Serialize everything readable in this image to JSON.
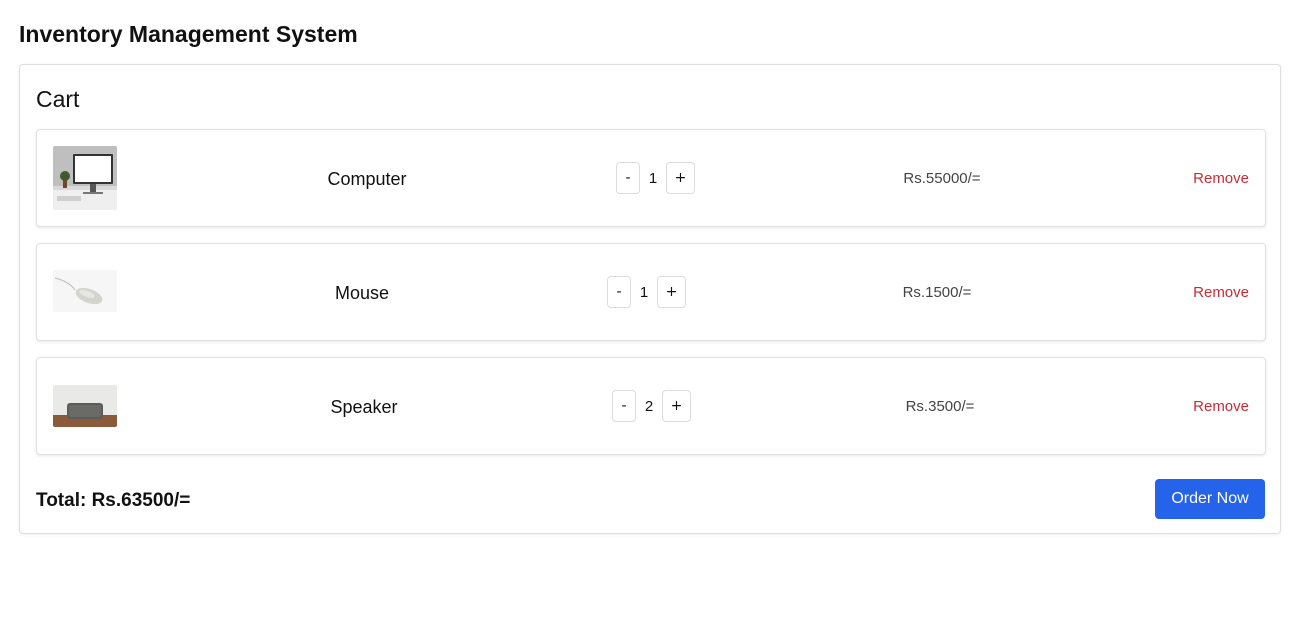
{
  "app": {
    "title": "Inventory Management System"
  },
  "cart": {
    "title": "Cart",
    "items": [
      {
        "name": "Computer",
        "quantity": "1",
        "price": "Rs.55000/=",
        "remove_label": "Remove",
        "image_icon": "computer-image"
      },
      {
        "name": "Mouse",
        "quantity": "1",
        "price": "Rs.1500/=",
        "remove_label": "Remove",
        "image_icon": "mouse-image"
      },
      {
        "name": "Speaker",
        "quantity": "2",
        "price": "Rs.3500/=",
        "remove_label": "Remove",
        "image_icon": "speaker-image"
      }
    ],
    "decrement_label": "-",
    "increment_label": "+",
    "total_text": "Total: Rs.63500/=",
    "order_button_label": "Order Now"
  },
  "colors": {
    "accent": "#2563eb",
    "remove": "#cc2b36",
    "border": "#e2e2e2"
  }
}
